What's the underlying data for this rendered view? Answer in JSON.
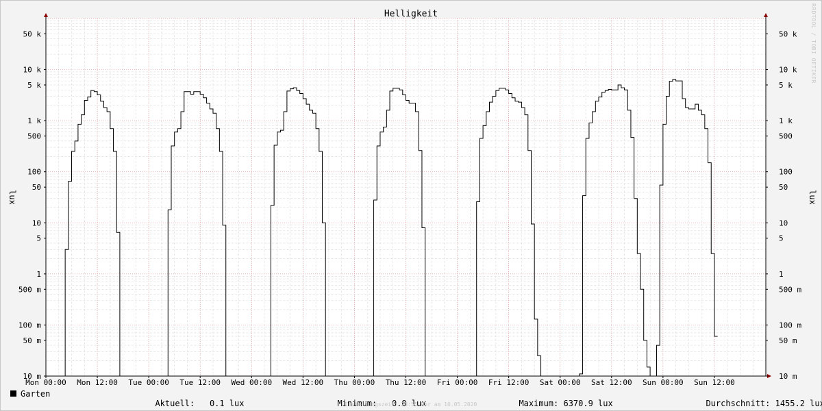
{
  "chart_data": {
    "type": "line",
    "title": "Helligkeit",
    "ylabel": "lux",
    "y_scale": "log",
    "ylim": [
      0.01,
      100000
    ],
    "y_ticks": [
      {
        "value": 0.01,
        "label": "10 m"
      },
      {
        "value": 0.05,
        "label": "50 m"
      },
      {
        "value": 0.1,
        "label": "100 m"
      },
      {
        "value": 0.5,
        "label": "500 m"
      },
      {
        "value": 1,
        "label": "1"
      },
      {
        "value": 5,
        "label": "5"
      },
      {
        "value": 10,
        "label": "10"
      },
      {
        "value": 50,
        "label": "50"
      },
      {
        "value": 100,
        "label": "100"
      },
      {
        "value": 500,
        "label": "500"
      },
      {
        "value": 1000,
        "label": "1 k"
      },
      {
        "value": 5000,
        "label": "5 k"
      },
      {
        "value": 10000,
        "label": "10 k"
      },
      {
        "value": 50000,
        "label": "50 k"
      }
    ],
    "x_ticks": [
      "Mon 00:00",
      "Mon 12:00",
      "Tue 00:00",
      "Tue 12:00",
      "Wed 00:00",
      "Wed 12:00",
      "Thu 00:00",
      "Thu 12:00",
      "Fri 00:00",
      "Fri 12:00",
      "Sat 00:00",
      "Sat 12:00",
      "Sun 00:00",
      "Sun 12:00"
    ],
    "x_range_hours": [
      0,
      168
    ],
    "grid": true,
    "series": [
      {
        "name": "Garten",
        "color": "#000000",
        "points": [
          [
            0,
            0.01
          ],
          [
            4.5,
            0.01
          ],
          [
            4.5,
            3
          ],
          [
            5.25,
            3
          ],
          [
            5.25,
            65
          ],
          [
            6,
            65
          ],
          [
            6,
            250
          ],
          [
            6.75,
            250
          ],
          [
            6.75,
            400
          ],
          [
            7.5,
            400
          ],
          [
            7.5,
            850
          ],
          [
            8.25,
            850
          ],
          [
            8.25,
            1300
          ],
          [
            9,
            1300
          ],
          [
            9,
            2500
          ],
          [
            9.75,
            2500
          ],
          [
            9.75,
            2900
          ],
          [
            10.5,
            2900
          ],
          [
            10.5,
            3900
          ],
          [
            11.25,
            3900
          ],
          [
            11.25,
            3700
          ],
          [
            12,
            3700
          ],
          [
            12,
            3200
          ],
          [
            12.75,
            3200
          ],
          [
            12.75,
            2400
          ],
          [
            13.5,
            2400
          ],
          [
            13.5,
            1800
          ],
          [
            14.25,
            1800
          ],
          [
            14.25,
            1500
          ],
          [
            15,
            1500
          ],
          [
            15,
            700
          ],
          [
            15.75,
            700
          ],
          [
            15.75,
            250
          ],
          [
            16.5,
            250
          ],
          [
            16.5,
            6.5
          ],
          [
            17.25,
            6.5
          ],
          [
            17.25,
            0.01
          ],
          [
            28.5,
            0.01
          ],
          [
            28.5,
            18
          ],
          [
            29.25,
            18
          ],
          [
            29.25,
            320
          ],
          [
            30,
            320
          ],
          [
            30,
            600
          ],
          [
            30.75,
            600
          ],
          [
            30.75,
            700
          ],
          [
            31.5,
            700
          ],
          [
            31.5,
            1500
          ],
          [
            32.25,
            1500
          ],
          [
            32.25,
            3700
          ],
          [
            33.75,
            3700
          ],
          [
            33.75,
            3300
          ],
          [
            34.5,
            3300
          ],
          [
            34.5,
            3700
          ],
          [
            36,
            3700
          ],
          [
            36,
            3300
          ],
          [
            36.75,
            3300
          ],
          [
            36.75,
            2800
          ],
          [
            37.5,
            2800
          ],
          [
            37.5,
            2200
          ],
          [
            38.25,
            2200
          ],
          [
            38.25,
            1700
          ],
          [
            39,
            1700
          ],
          [
            39,
            1400
          ],
          [
            39.75,
            1400
          ],
          [
            39.75,
            700
          ],
          [
            40.5,
            700
          ],
          [
            40.5,
            250
          ],
          [
            41.25,
            250
          ],
          [
            41.25,
            9
          ],
          [
            42,
            9
          ],
          [
            42,
            0.01
          ],
          [
            52.5,
            0.01
          ],
          [
            52.5,
            22
          ],
          [
            53.25,
            22
          ],
          [
            53.25,
            330
          ],
          [
            54,
            330
          ],
          [
            54,
            600
          ],
          [
            54.75,
            600
          ],
          [
            54.75,
            650
          ],
          [
            55.5,
            650
          ],
          [
            55.5,
            1500
          ],
          [
            56.25,
            1500
          ],
          [
            56.25,
            3800
          ],
          [
            57,
            3800
          ],
          [
            57,
            4200
          ],
          [
            57.75,
            4200
          ],
          [
            57.75,
            4400
          ],
          [
            58.5,
            4400
          ],
          [
            58.5,
            3900
          ],
          [
            59.25,
            3900
          ],
          [
            59.25,
            3400
          ],
          [
            60,
            3400
          ],
          [
            60,
            2700
          ],
          [
            60.75,
            2700
          ],
          [
            60.75,
            2100
          ],
          [
            61.5,
            2100
          ],
          [
            61.5,
            1600
          ],
          [
            62.25,
            1600
          ],
          [
            62.25,
            1400
          ],
          [
            63,
            1400
          ],
          [
            63,
            700
          ],
          [
            63.75,
            700
          ],
          [
            63.75,
            250
          ],
          [
            64.5,
            250
          ],
          [
            64.5,
            10
          ],
          [
            65.25,
            10
          ],
          [
            65.25,
            0.01
          ],
          [
            76.5,
            0.01
          ],
          [
            76.5,
            28
          ],
          [
            77.25,
            28
          ],
          [
            77.25,
            320
          ],
          [
            78,
            320
          ],
          [
            78,
            600
          ],
          [
            78.75,
            600
          ],
          [
            78.75,
            750
          ],
          [
            79.5,
            750
          ],
          [
            79.5,
            1600
          ],
          [
            80.25,
            1600
          ],
          [
            80.25,
            3800
          ],
          [
            81,
            3800
          ],
          [
            81,
            4300
          ],
          [
            82.5,
            4300
          ],
          [
            82.5,
            4000
          ],
          [
            83.25,
            4000
          ],
          [
            83.25,
            3200
          ],
          [
            84,
            3200
          ],
          [
            84,
            2500
          ],
          [
            84.75,
            2500
          ],
          [
            84.75,
            2200
          ],
          [
            86.25,
            2200
          ],
          [
            86.25,
            1500
          ],
          [
            87,
            1500
          ],
          [
            87,
            260
          ],
          [
            87.75,
            260
          ],
          [
            87.75,
            8
          ],
          [
            88.5,
            8
          ],
          [
            88.5,
            0.01
          ],
          [
            100.5,
            0.01
          ],
          [
            100.5,
            26
          ],
          [
            101.25,
            26
          ],
          [
            101.25,
            450
          ],
          [
            102,
            450
          ],
          [
            102,
            800
          ],
          [
            102.75,
            800
          ],
          [
            102.75,
            1500
          ],
          [
            103.5,
            1500
          ],
          [
            103.5,
            2300
          ],
          [
            104.25,
            2300
          ],
          [
            104.25,
            3000
          ],
          [
            105,
            3000
          ],
          [
            105,
            3900
          ],
          [
            105.75,
            3900
          ],
          [
            105.75,
            4300
          ],
          [
            107.25,
            4300
          ],
          [
            107.25,
            4000
          ],
          [
            108,
            4000
          ],
          [
            108,
            3400
          ],
          [
            108.75,
            3400
          ],
          [
            108.75,
            2800
          ],
          [
            109.5,
            2800
          ],
          [
            109.5,
            2400
          ],
          [
            110.25,
            2400
          ],
          [
            110.25,
            2300
          ],
          [
            111,
            2300
          ],
          [
            111,
            1800
          ],
          [
            111.75,
            1800
          ],
          [
            111.75,
            1300
          ],
          [
            112.5,
            1300
          ],
          [
            112.5,
            260
          ],
          [
            113.25,
            260
          ],
          [
            113.25,
            9.5
          ],
          [
            114,
            9.5
          ],
          [
            114,
            0.13
          ],
          [
            114.75,
            0.13
          ],
          [
            114.75,
            0.025
          ],
          [
            115.5,
            0.025
          ],
          [
            115.5,
            0.005
          ],
          [
            124.5,
            0.005
          ],
          [
            124.5,
            0.011
          ],
          [
            125.25,
            0.011
          ],
          [
            125.25,
            34
          ],
          [
            126,
            34
          ],
          [
            126,
            450
          ],
          [
            126.75,
            450
          ],
          [
            126.75,
            900
          ],
          [
            127.5,
            900
          ],
          [
            127.5,
            1500
          ],
          [
            128.25,
            1500
          ],
          [
            128.25,
            2400
          ],
          [
            129,
            2400
          ],
          [
            129,
            2900
          ],
          [
            129.75,
            2900
          ],
          [
            129.75,
            3600
          ],
          [
            130.5,
            3600
          ],
          [
            130.5,
            3900
          ],
          [
            131.25,
            3900
          ],
          [
            131.25,
            4100
          ],
          [
            132,
            4100
          ],
          [
            132,
            4000
          ],
          [
            133.5,
            4000
          ],
          [
            133.5,
            5000
          ],
          [
            134.25,
            5000
          ],
          [
            134.25,
            4400
          ],
          [
            135,
            4400
          ],
          [
            135,
            4000
          ],
          [
            135.75,
            4000
          ],
          [
            135.75,
            1600
          ],
          [
            136.5,
            1600
          ],
          [
            136.5,
            470
          ],
          [
            137.25,
            470
          ],
          [
            137.25,
            30
          ],
          [
            138,
            30
          ],
          [
            138,
            2.5
          ],
          [
            138.75,
            2.5
          ],
          [
            138.75,
            0.5
          ],
          [
            139.5,
            0.5
          ],
          [
            139.5,
            0.05
          ],
          [
            140.25,
            0.05
          ],
          [
            140.25,
            0.015
          ],
          [
            141,
            0.015
          ],
          [
            141,
            0.01
          ],
          [
            142.5,
            0.01
          ],
          [
            142.5,
            0.04
          ],
          [
            143.25,
            0.04
          ],
          [
            143.25,
            55
          ],
          [
            144,
            55
          ],
          [
            144,
            850
          ],
          [
            144.75,
            850
          ],
          [
            144.75,
            3000
          ],
          [
            145.5,
            3000
          ],
          [
            145.5,
            5900
          ],
          [
            146.25,
            5900
          ],
          [
            146.25,
            6370.9
          ],
          [
            147,
            6370.9
          ],
          [
            147,
            6000
          ],
          [
            148.5,
            6000
          ],
          [
            148.5,
            2700
          ],
          [
            149.25,
            2700
          ],
          [
            149.25,
            1800
          ],
          [
            150,
            1800
          ],
          [
            150,
            1700
          ],
          [
            151.5,
            1700
          ],
          [
            151.5,
            2100
          ],
          [
            152.25,
            2100
          ],
          [
            152.25,
            1600
          ],
          [
            153,
            1600
          ],
          [
            153,
            1300
          ],
          [
            153.75,
            1300
          ],
          [
            153.75,
            700
          ],
          [
            154.5,
            700
          ],
          [
            154.5,
            150
          ],
          [
            155.25,
            150
          ],
          [
            155.25,
            2.5
          ],
          [
            156,
            2.5
          ],
          [
            156,
            0.06
          ],
          [
            156.75,
            0.06
          ]
        ]
      }
    ],
    "legend": {
      "name": "Garten",
      "current_label": "Aktuell:",
      "current_value": "0.1 lux",
      "min_label": "Minimum:",
      "min_value": "0.0 lux",
      "max_label": "Maximum:",
      "max_value": "6370.9 lux",
      "avg_label": "Durchschnitt:",
      "avg_value": "1455.2 lux"
    }
  },
  "footer": "Erstellungszeit: 23:55 Uhr am 10.05.2020",
  "watermark": "RRDTOOL / TOBI OETIKER"
}
